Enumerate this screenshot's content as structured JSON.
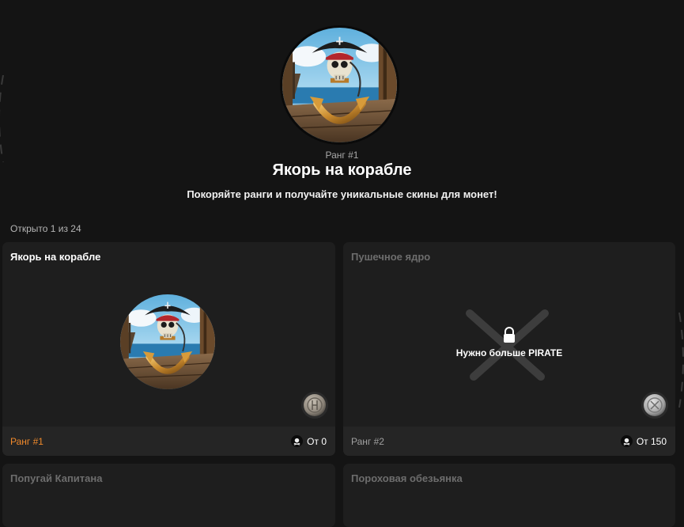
{
  "hero": {
    "rank_label": "Ранг #1",
    "title": "Якорь на корабле",
    "subtitle": "Покоряйте ранги и получайте уникальные скины для монет!"
  },
  "progress": {
    "counter_text": "Открыто 1 из 24",
    "opened": 1,
    "total": 24
  },
  "cards": [
    {
      "name": "Якорь на корабле",
      "rank": "Ранг #1",
      "price": "От 0",
      "status": "unlocked"
    },
    {
      "name": "Пушечное ядро",
      "rank": "Ранг #2",
      "price": "От 150",
      "status": "locked",
      "lock_text": "Нужно больше PIRATE"
    },
    {
      "name": "Попугай Капитана",
      "status": "locked"
    },
    {
      "name": "Пороховая обезьянка",
      "status": "locked"
    }
  ],
  "colors": {
    "background": "#141414",
    "card": "#1e1e1e",
    "footer": "#252525",
    "accent_rank": "#f0892b",
    "muted_title": "#6d6d6d"
  },
  "icons": [
    "skull-anchor-art",
    "coin-icon",
    "lock-icon",
    "jolly-roger-icon"
  ]
}
